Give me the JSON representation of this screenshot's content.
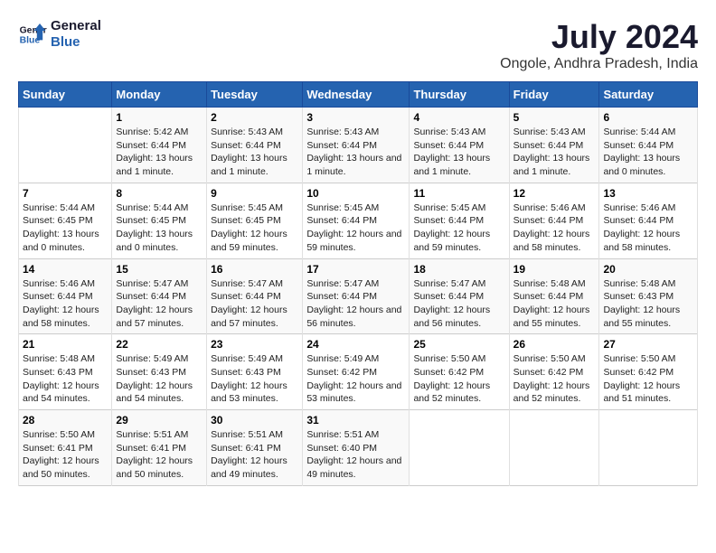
{
  "header": {
    "logo_line1": "General",
    "logo_line2": "Blue",
    "title": "July 2024",
    "subtitle": "Ongole, Andhra Pradesh, India"
  },
  "days_of_week": [
    "Sunday",
    "Monday",
    "Tuesday",
    "Wednesday",
    "Thursday",
    "Friday",
    "Saturday"
  ],
  "weeks": [
    [
      {
        "day": "",
        "sunrise": "",
        "sunset": "",
        "daylight": ""
      },
      {
        "day": "1",
        "sunrise": "5:42 AM",
        "sunset": "6:44 PM",
        "daylight": "13 hours and 1 minute."
      },
      {
        "day": "2",
        "sunrise": "5:43 AM",
        "sunset": "6:44 PM",
        "daylight": "13 hours and 1 minute."
      },
      {
        "day": "3",
        "sunrise": "5:43 AM",
        "sunset": "6:44 PM",
        "daylight": "13 hours and 1 minute."
      },
      {
        "day": "4",
        "sunrise": "5:43 AM",
        "sunset": "6:44 PM",
        "daylight": "13 hours and 1 minute."
      },
      {
        "day": "5",
        "sunrise": "5:43 AM",
        "sunset": "6:44 PM",
        "daylight": "13 hours and 1 minute."
      },
      {
        "day": "6",
        "sunrise": "5:44 AM",
        "sunset": "6:44 PM",
        "daylight": "13 hours and 0 minutes."
      }
    ],
    [
      {
        "day": "7",
        "sunrise": "5:44 AM",
        "sunset": "6:45 PM",
        "daylight": "13 hours and 0 minutes."
      },
      {
        "day": "8",
        "sunrise": "5:44 AM",
        "sunset": "6:45 PM",
        "daylight": "13 hours and 0 minutes."
      },
      {
        "day": "9",
        "sunrise": "5:45 AM",
        "sunset": "6:45 PM",
        "daylight": "12 hours and 59 minutes."
      },
      {
        "day": "10",
        "sunrise": "5:45 AM",
        "sunset": "6:44 PM",
        "daylight": "12 hours and 59 minutes."
      },
      {
        "day": "11",
        "sunrise": "5:45 AM",
        "sunset": "6:44 PM",
        "daylight": "12 hours and 59 minutes."
      },
      {
        "day": "12",
        "sunrise": "5:46 AM",
        "sunset": "6:44 PM",
        "daylight": "12 hours and 58 minutes."
      },
      {
        "day": "13",
        "sunrise": "5:46 AM",
        "sunset": "6:44 PM",
        "daylight": "12 hours and 58 minutes."
      }
    ],
    [
      {
        "day": "14",
        "sunrise": "5:46 AM",
        "sunset": "6:44 PM",
        "daylight": "12 hours and 58 minutes."
      },
      {
        "day": "15",
        "sunrise": "5:47 AM",
        "sunset": "6:44 PM",
        "daylight": "12 hours and 57 minutes."
      },
      {
        "day": "16",
        "sunrise": "5:47 AM",
        "sunset": "6:44 PM",
        "daylight": "12 hours and 57 minutes."
      },
      {
        "day": "17",
        "sunrise": "5:47 AM",
        "sunset": "6:44 PM",
        "daylight": "12 hours and 56 minutes."
      },
      {
        "day": "18",
        "sunrise": "5:47 AM",
        "sunset": "6:44 PM",
        "daylight": "12 hours and 56 minutes."
      },
      {
        "day": "19",
        "sunrise": "5:48 AM",
        "sunset": "6:44 PM",
        "daylight": "12 hours and 55 minutes."
      },
      {
        "day": "20",
        "sunrise": "5:48 AM",
        "sunset": "6:43 PM",
        "daylight": "12 hours and 55 minutes."
      }
    ],
    [
      {
        "day": "21",
        "sunrise": "5:48 AM",
        "sunset": "6:43 PM",
        "daylight": "12 hours and 54 minutes."
      },
      {
        "day": "22",
        "sunrise": "5:49 AM",
        "sunset": "6:43 PM",
        "daylight": "12 hours and 54 minutes."
      },
      {
        "day": "23",
        "sunrise": "5:49 AM",
        "sunset": "6:43 PM",
        "daylight": "12 hours and 53 minutes."
      },
      {
        "day": "24",
        "sunrise": "5:49 AM",
        "sunset": "6:42 PM",
        "daylight": "12 hours and 53 minutes."
      },
      {
        "day": "25",
        "sunrise": "5:50 AM",
        "sunset": "6:42 PM",
        "daylight": "12 hours and 52 minutes."
      },
      {
        "day": "26",
        "sunrise": "5:50 AM",
        "sunset": "6:42 PM",
        "daylight": "12 hours and 52 minutes."
      },
      {
        "day": "27",
        "sunrise": "5:50 AM",
        "sunset": "6:42 PM",
        "daylight": "12 hours and 51 minutes."
      }
    ],
    [
      {
        "day": "28",
        "sunrise": "5:50 AM",
        "sunset": "6:41 PM",
        "daylight": "12 hours and 50 minutes."
      },
      {
        "day": "29",
        "sunrise": "5:51 AM",
        "sunset": "6:41 PM",
        "daylight": "12 hours and 50 minutes."
      },
      {
        "day": "30",
        "sunrise": "5:51 AM",
        "sunset": "6:41 PM",
        "daylight": "12 hours and 49 minutes."
      },
      {
        "day": "31",
        "sunrise": "5:51 AM",
        "sunset": "6:40 PM",
        "daylight": "12 hours and 49 minutes."
      },
      {
        "day": "",
        "sunrise": "",
        "sunset": "",
        "daylight": ""
      },
      {
        "day": "",
        "sunrise": "",
        "sunset": "",
        "daylight": ""
      },
      {
        "day": "",
        "sunrise": "",
        "sunset": "",
        "daylight": ""
      }
    ]
  ]
}
